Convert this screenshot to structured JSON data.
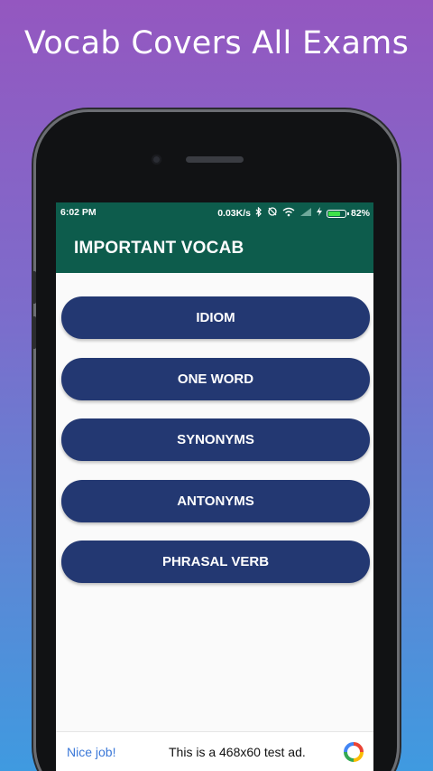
{
  "promo": {
    "headline": "Vocab Covers All Exams"
  },
  "status_bar": {
    "time": "6:02 PM",
    "net_speed": "0.03K/s",
    "battery_percent": "82%",
    "battery_level": 0.82
  },
  "app_bar": {
    "title": "IMPORTANT VOCAB"
  },
  "menu": {
    "items": [
      {
        "label": "IDIOM"
      },
      {
        "label": "ONE WORD"
      },
      {
        "label": "SYNONYMS"
      },
      {
        "label": "ANTONYMS"
      },
      {
        "label": "PHRASAL VERB"
      }
    ]
  },
  "ad_banner": {
    "nice_text": "Nice job!",
    "body_text": "This is a 468x60 test ad."
  },
  "colors": {
    "app_bar": "#0d5c4c",
    "button": "#233872",
    "battery": "#3fe24a",
    "ad_link": "#3b78d8"
  },
  "icons": [
    "bluetooth-icon",
    "data-saver-icon",
    "wifi-icon",
    "signal-icon",
    "charging-icon",
    "battery-icon",
    "ad-logo-icon"
  ]
}
